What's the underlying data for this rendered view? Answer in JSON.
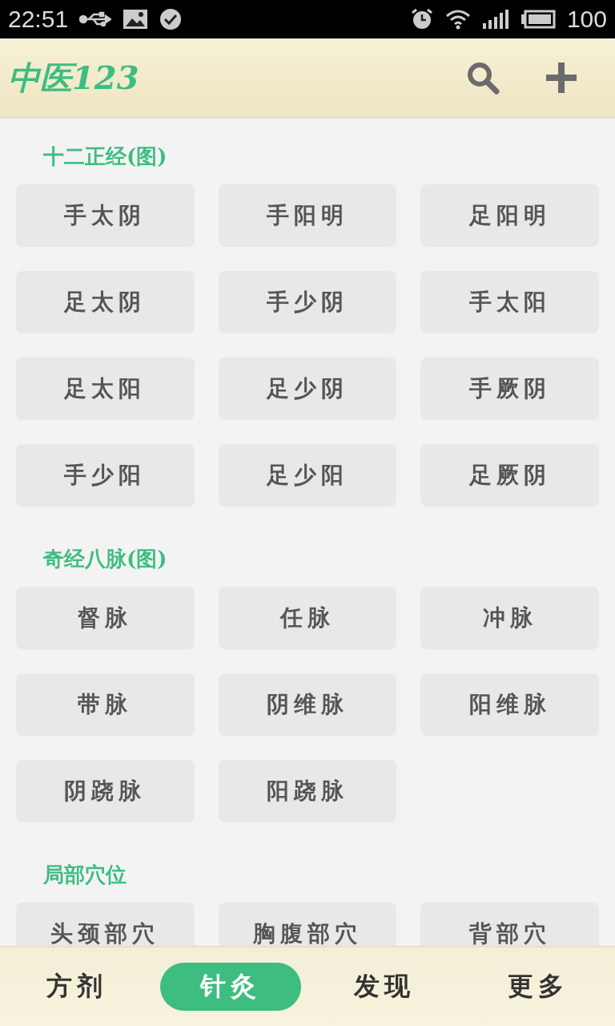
{
  "status_bar": {
    "time": "22:51",
    "battery": "100"
  },
  "header": {
    "title": "中医123"
  },
  "sections": [
    {
      "title": "十二正经(图)",
      "items": [
        "手太阴",
        "手阳明",
        "足阳明",
        "足太阴",
        "手少阴",
        "手太阳",
        "足太阳",
        "足少阴",
        "手厥阴",
        "手少阳",
        "足少阳",
        "足厥阴"
      ]
    },
    {
      "title": "奇经八脉(图)",
      "items": [
        "督脉",
        "任脉",
        "冲脉",
        "带脉",
        "阴维脉",
        "阳维脉",
        "阴跷脉",
        "阳跷脉"
      ]
    },
    {
      "title": "局部穴位",
      "items": [
        "头颈部穴",
        "胸腹部穴",
        "背部穴"
      ]
    }
  ],
  "tabs": [
    {
      "label": "方剂",
      "selected": false
    },
    {
      "label": "针灸",
      "selected": true
    },
    {
      "label": "发现",
      "selected": false
    },
    {
      "label": "更多",
      "selected": false
    }
  ]
}
